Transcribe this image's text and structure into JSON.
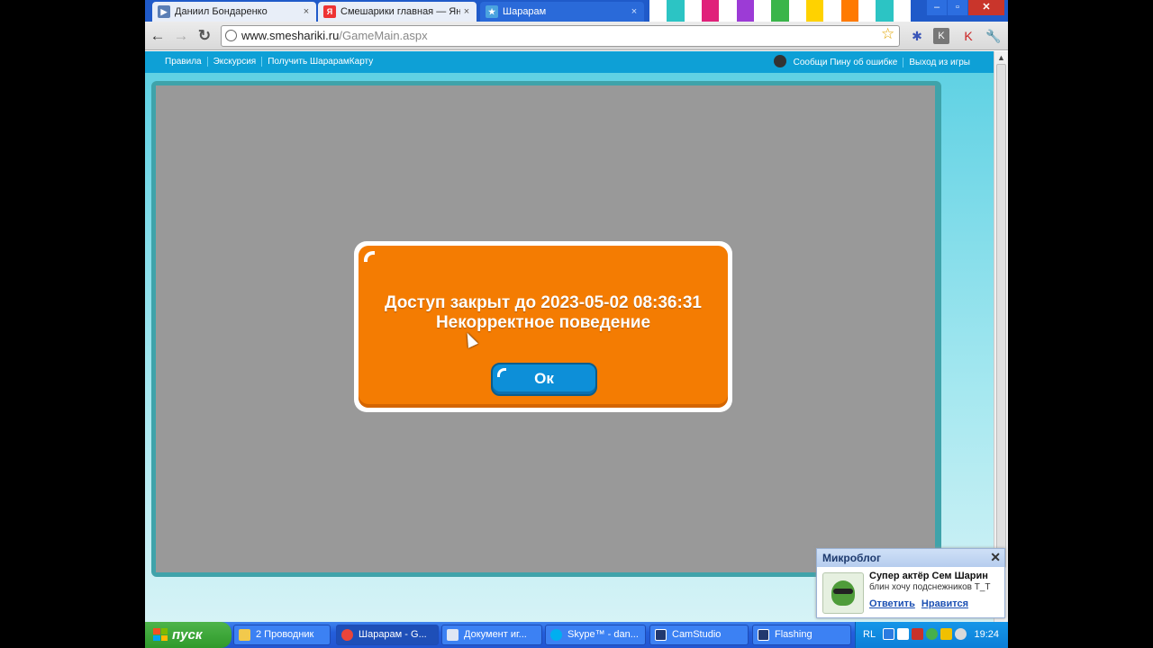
{
  "browser": {
    "tabs": [
      {
        "label": "Даниил Бондаренко",
        "favicon_color": "#5b7fb5",
        "active": false
      },
      {
        "label": "Смешарики главная — Яндекс",
        "favicon_color": "#e33",
        "active": false
      },
      {
        "label": "Шарарам",
        "favicon_color": "#4aa3df",
        "active": true
      }
    ],
    "tab_close": "×",
    "window_buttons": {
      "minimize": "–",
      "maximize": "▫",
      "close": "✕"
    },
    "url": {
      "domain": "www.smeshariki.ru",
      "path": "/GameMain.aspx"
    }
  },
  "game_nav": {
    "left_links": [
      "Правила",
      "Экскурсия",
      "Получить ШарарамКарту"
    ],
    "report_bug": "Сообщи Пину об ошибке",
    "exit": "Выход из игры"
  },
  "dialog": {
    "line1": "Доступ закрыт до 2023-05-02 08:36:31",
    "line2": "Некорректное поведение",
    "ok_label": "Ок"
  },
  "microblog": {
    "title": "Микроблог",
    "close": "✕",
    "author": "Супер актёр Сем Шарин",
    "message": "блин хочу подснежников Т_Т",
    "reply": "Ответить",
    "like": "Нравится"
  },
  "taskbar": {
    "start": "пуск",
    "tasks": [
      {
        "label": "2 Проводник",
        "icon_color": "#f2c94c"
      },
      {
        "label": "Шарарам - G...",
        "icon_color": "#e9453a"
      },
      {
        "label": "Документ иг...",
        "icon_color": "#dfe6f3"
      },
      {
        "label": "Skype™ - dan...",
        "icon_color": "#00aff0"
      },
      {
        "label": "CamStudio",
        "icon_color": "#22386e"
      },
      {
        "label": "Flashing",
        "icon_color": "#22386e"
      }
    ],
    "lang": "RL",
    "clock": "19:24"
  },
  "colors": {
    "dialog_orange": "#f47c02",
    "ok_blue": "#0d8fd8",
    "game_gray": "#999999",
    "nav_blue": "#0ea0d6"
  }
}
